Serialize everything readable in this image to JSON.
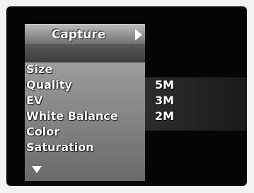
{
  "menu": {
    "title": "Capture",
    "items": [
      {
        "label": "Size"
      },
      {
        "label": "Quality"
      },
      {
        "label": "EV"
      },
      {
        "label": "White Balance"
      },
      {
        "label": "Color"
      },
      {
        "label": "Saturation"
      }
    ]
  },
  "submenu": {
    "options": [
      "5M",
      "3M",
      "2M"
    ]
  }
}
